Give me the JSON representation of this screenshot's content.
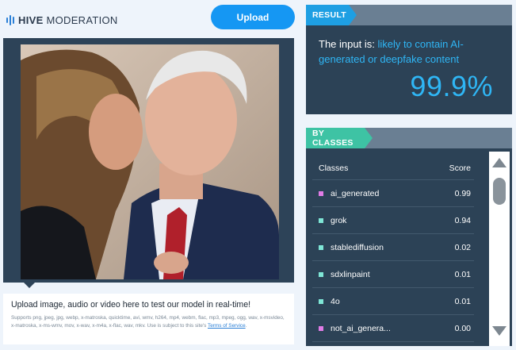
{
  "header": {
    "logo_brand": "HIVE",
    "logo_product": "MODERATION",
    "upload_label": "Upload"
  },
  "upload_info": {
    "title": "Upload image, audio or video here to test our model in real-time!",
    "supported_formats": "Supports png, jpeg, jpg, webp, x-matroska, quicktime, avi, wmv, h264, mp4, webm, flac, mp3, mpeg, ogg, wav, x-msvideo, x-matroska, x-ms-wmv, mov, x-wav, x-m4a, x-flac, wav, mkv. Use is subject to this site's",
    "terms_link": "Terms of Service",
    "terms_end": "."
  },
  "result": {
    "tag": "RESULT",
    "prefix": "The input is: ",
    "verdict": "likely to contain AI-generated or deepfake content",
    "score": "99.9%"
  },
  "classes": {
    "tag": "BY CLASSES",
    "col_classes": "Classes",
    "col_score": "Score",
    "rows": [
      {
        "name": "ai_generated",
        "score": "0.99",
        "color": "#e07ce6"
      },
      {
        "name": "grok",
        "score": "0.94",
        "color": "#7fe6d6"
      },
      {
        "name": "stablediffusion",
        "score": "0.02",
        "color": "#7fe6d6"
      },
      {
        "name": "sdxlinpaint",
        "score": "0.01",
        "color": "#7fe6d6"
      },
      {
        "name": "4o",
        "score": "0.01",
        "color": "#7fe6d6"
      },
      {
        "name": "not_ai_genera...",
        "score": "0.00",
        "color": "#e07ce6"
      }
    ]
  },
  "colors": {
    "accent_blue": "#1597f3",
    "result_highlight": "#2fb6f5",
    "panel_bg": "#2c4256",
    "classes_tag": "#3ec3a4"
  }
}
